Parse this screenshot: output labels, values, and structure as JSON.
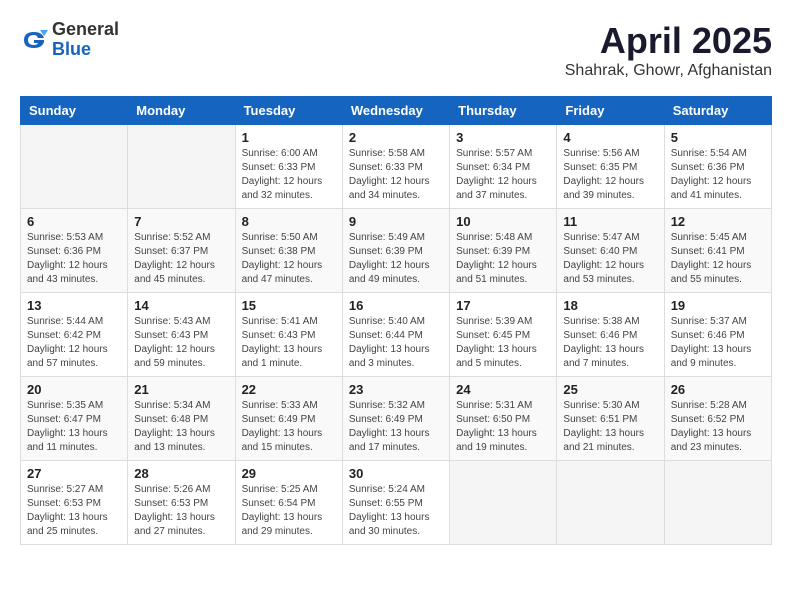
{
  "header": {
    "logo_general": "General",
    "logo_blue": "Blue",
    "month_year": "April 2025",
    "location": "Shahrak, Ghowr, Afghanistan"
  },
  "days_of_week": [
    "Sunday",
    "Monday",
    "Tuesday",
    "Wednesday",
    "Thursday",
    "Friday",
    "Saturday"
  ],
  "weeks": [
    [
      {
        "day": null,
        "info": null
      },
      {
        "day": null,
        "info": null
      },
      {
        "day": "1",
        "info": "Sunrise: 6:00 AM\nSunset: 6:33 PM\nDaylight: 12 hours\nand 32 minutes."
      },
      {
        "day": "2",
        "info": "Sunrise: 5:58 AM\nSunset: 6:33 PM\nDaylight: 12 hours\nand 34 minutes."
      },
      {
        "day": "3",
        "info": "Sunrise: 5:57 AM\nSunset: 6:34 PM\nDaylight: 12 hours\nand 37 minutes."
      },
      {
        "day": "4",
        "info": "Sunrise: 5:56 AM\nSunset: 6:35 PM\nDaylight: 12 hours\nand 39 minutes."
      },
      {
        "day": "5",
        "info": "Sunrise: 5:54 AM\nSunset: 6:36 PM\nDaylight: 12 hours\nand 41 minutes."
      }
    ],
    [
      {
        "day": "6",
        "info": "Sunrise: 5:53 AM\nSunset: 6:36 PM\nDaylight: 12 hours\nand 43 minutes."
      },
      {
        "day": "7",
        "info": "Sunrise: 5:52 AM\nSunset: 6:37 PM\nDaylight: 12 hours\nand 45 minutes."
      },
      {
        "day": "8",
        "info": "Sunrise: 5:50 AM\nSunset: 6:38 PM\nDaylight: 12 hours\nand 47 minutes."
      },
      {
        "day": "9",
        "info": "Sunrise: 5:49 AM\nSunset: 6:39 PM\nDaylight: 12 hours\nand 49 minutes."
      },
      {
        "day": "10",
        "info": "Sunrise: 5:48 AM\nSunset: 6:39 PM\nDaylight: 12 hours\nand 51 minutes."
      },
      {
        "day": "11",
        "info": "Sunrise: 5:47 AM\nSunset: 6:40 PM\nDaylight: 12 hours\nand 53 minutes."
      },
      {
        "day": "12",
        "info": "Sunrise: 5:45 AM\nSunset: 6:41 PM\nDaylight: 12 hours\nand 55 minutes."
      }
    ],
    [
      {
        "day": "13",
        "info": "Sunrise: 5:44 AM\nSunset: 6:42 PM\nDaylight: 12 hours\nand 57 minutes."
      },
      {
        "day": "14",
        "info": "Sunrise: 5:43 AM\nSunset: 6:43 PM\nDaylight: 12 hours\nand 59 minutes."
      },
      {
        "day": "15",
        "info": "Sunrise: 5:41 AM\nSunset: 6:43 PM\nDaylight: 13 hours\nand 1 minute."
      },
      {
        "day": "16",
        "info": "Sunrise: 5:40 AM\nSunset: 6:44 PM\nDaylight: 13 hours\nand 3 minutes."
      },
      {
        "day": "17",
        "info": "Sunrise: 5:39 AM\nSunset: 6:45 PM\nDaylight: 13 hours\nand 5 minutes."
      },
      {
        "day": "18",
        "info": "Sunrise: 5:38 AM\nSunset: 6:46 PM\nDaylight: 13 hours\nand 7 minutes."
      },
      {
        "day": "19",
        "info": "Sunrise: 5:37 AM\nSunset: 6:46 PM\nDaylight: 13 hours\nand 9 minutes."
      }
    ],
    [
      {
        "day": "20",
        "info": "Sunrise: 5:35 AM\nSunset: 6:47 PM\nDaylight: 13 hours\nand 11 minutes."
      },
      {
        "day": "21",
        "info": "Sunrise: 5:34 AM\nSunset: 6:48 PM\nDaylight: 13 hours\nand 13 minutes."
      },
      {
        "day": "22",
        "info": "Sunrise: 5:33 AM\nSunset: 6:49 PM\nDaylight: 13 hours\nand 15 minutes."
      },
      {
        "day": "23",
        "info": "Sunrise: 5:32 AM\nSunset: 6:49 PM\nDaylight: 13 hours\nand 17 minutes."
      },
      {
        "day": "24",
        "info": "Sunrise: 5:31 AM\nSunset: 6:50 PM\nDaylight: 13 hours\nand 19 minutes."
      },
      {
        "day": "25",
        "info": "Sunrise: 5:30 AM\nSunset: 6:51 PM\nDaylight: 13 hours\nand 21 minutes."
      },
      {
        "day": "26",
        "info": "Sunrise: 5:28 AM\nSunset: 6:52 PM\nDaylight: 13 hours\nand 23 minutes."
      }
    ],
    [
      {
        "day": "27",
        "info": "Sunrise: 5:27 AM\nSunset: 6:53 PM\nDaylight: 13 hours\nand 25 minutes."
      },
      {
        "day": "28",
        "info": "Sunrise: 5:26 AM\nSunset: 6:53 PM\nDaylight: 13 hours\nand 27 minutes."
      },
      {
        "day": "29",
        "info": "Sunrise: 5:25 AM\nSunset: 6:54 PM\nDaylight: 13 hours\nand 29 minutes."
      },
      {
        "day": "30",
        "info": "Sunrise: 5:24 AM\nSunset: 6:55 PM\nDaylight: 13 hours\nand 30 minutes."
      },
      {
        "day": null,
        "info": null
      },
      {
        "day": null,
        "info": null
      },
      {
        "day": null,
        "info": null
      }
    ]
  ]
}
